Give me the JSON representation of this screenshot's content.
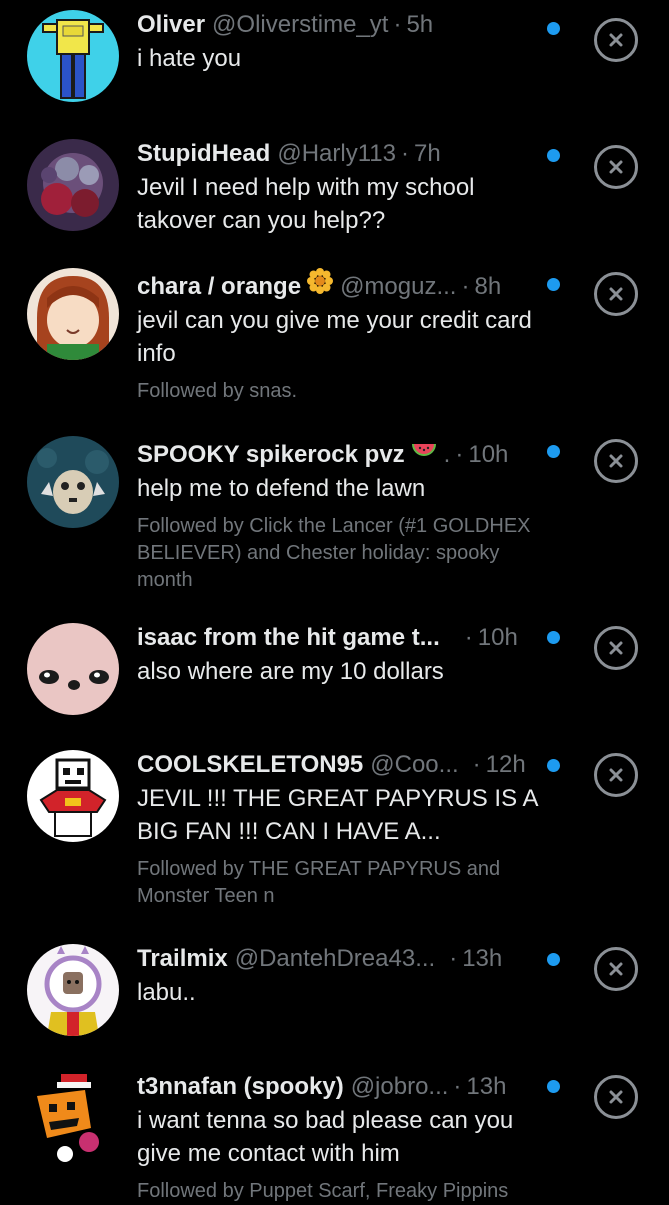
{
  "notifications": [
    {
      "name": "Oliver",
      "handle": "@Oliverstime_yt",
      "time": "5h",
      "message": "i hate you",
      "followed_by": "",
      "unread": true
    },
    {
      "name": "StupidHead",
      "handle": "@Harly113",
      "time": "7h",
      "message": "Jevil I need help with my school takover can you help??",
      "followed_by": "",
      "unread": true
    },
    {
      "name": "chara / orange",
      "name_emoji": "sunflower-emoji",
      "handle": "@moguz...",
      "time": "8h",
      "message": "jevil can you give me your credit card info",
      "followed_by": "Followed by snas.",
      "unread": true
    },
    {
      "name": "SPOOKY spikerock pvz",
      "name_emoji": "watermelon-emoji",
      "handle": ".",
      "time": "10h",
      "message": "help me to defend the lawn",
      "followed_by": "Followed by Click the Lancer (#1 GOLDHEX BELIEVER) and Chester holiday: spooky month",
      "unread": true
    },
    {
      "name": "isaac from the hit game t...",
      "handle": "",
      "time": "10h",
      "message": "also where are my 10 dollars",
      "followed_by": "",
      "unread": true
    },
    {
      "name": "COOLSKELETON95",
      "handle": "@Coo...",
      "time": "12h",
      "message": "JEVIL !!! THE GREAT PAPYRUS IS A BIG FAN !!! CAN I HAVE A...",
      "followed_by": "Followed by THE GREAT PAPYRUS and Monster Teen n",
      "unread": true
    },
    {
      "name": "Trailmix",
      "handle": "@DantehDrea43...",
      "time": "13h",
      "message": "labu..",
      "followed_by": "",
      "unread": true
    },
    {
      "name": "t3nnafan (spooky)",
      "handle": "@jobro...",
      "time": "13h",
      "message": "i want tenna so bad please can you give me contact with him",
      "followed_by": "Followed by Puppet Scarf, Freaky Pippins",
      "unread": true
    }
  ],
  "colors": {
    "background": "#000000",
    "primary_text": "#e7e9ea",
    "secondary_text": "#71767b",
    "unread_dot": "#1d9bf0",
    "close_icon": "#8b9096"
  },
  "icons": {
    "dismiss": "close-circle-icon",
    "unread": "unread-dot-icon"
  }
}
